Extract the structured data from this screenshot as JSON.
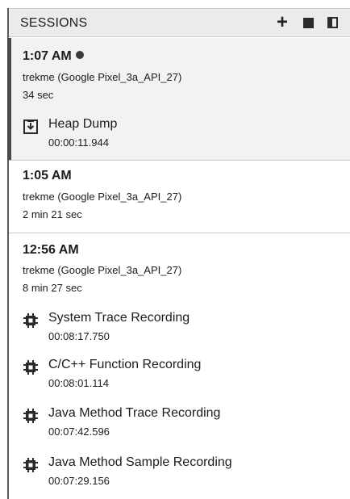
{
  "header": {
    "title": "SESSIONS",
    "add_icon": "plus-icon",
    "stop_icon": "stop-icon",
    "toggle_icon": "panel-toggle-icon"
  },
  "sessions": [
    {
      "time": "1:07 AM",
      "device": "trekme (Google Pixel_3a_API_27)",
      "duration": "34 sec",
      "recording": true,
      "selected": true,
      "artifacts": [
        {
          "label": "Heap Dump",
          "timestamp": "00:00:11.944",
          "icon": "heap-dump-icon"
        }
      ]
    },
    {
      "time": "1:05 AM",
      "device": "trekme (Google Pixel_3a_API_27)",
      "duration": "2 min 21 sec",
      "recording": false,
      "selected": false,
      "artifacts": []
    },
    {
      "time": "12:56 AM",
      "device": "trekme (Google Pixel_3a_API_27)",
      "duration": "8 min 27 sec",
      "recording": false,
      "selected": false,
      "artifacts": [
        {
          "label": "System Trace Recording",
          "timestamp": "00:08:17.750",
          "icon": "cpu-chip-icon"
        },
        {
          "label": "C/C++ Function Recording",
          "timestamp": "00:08:01.114",
          "icon": "cpu-chip-icon"
        },
        {
          "label": "Java Method Trace Recording",
          "timestamp": "00:07:42.596",
          "icon": "cpu-chip-icon"
        },
        {
          "label": "Java Method Sample Recording",
          "timestamp": "00:07:29.156",
          "icon": "cpu-chip-icon"
        }
      ]
    }
  ]
}
